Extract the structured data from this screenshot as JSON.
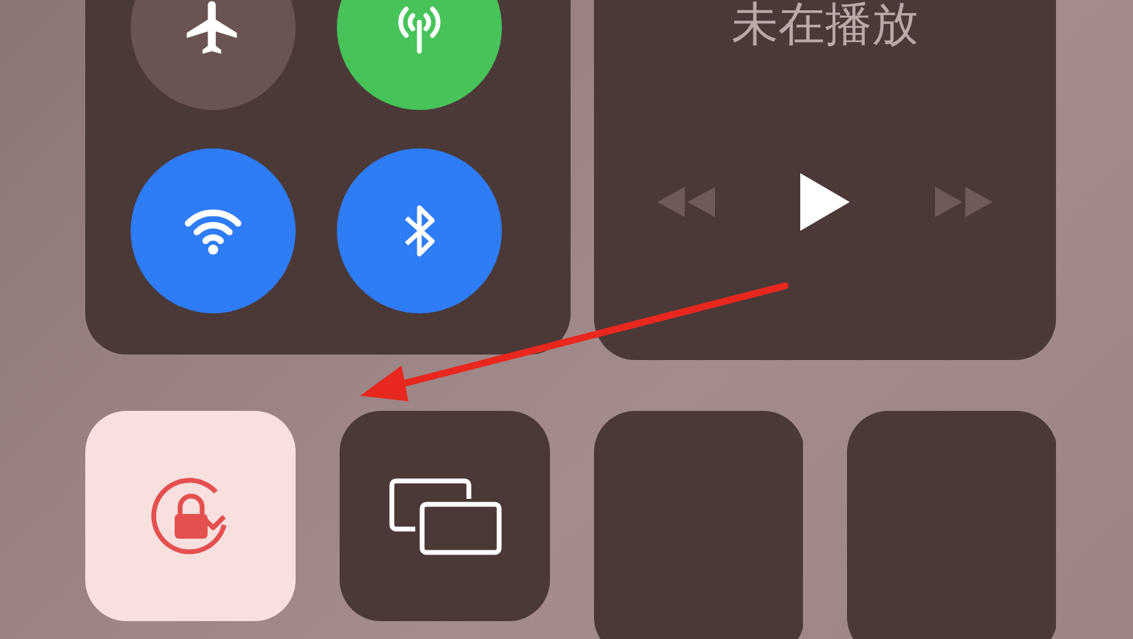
{
  "connectivity": [
    {
      "kind": "airplane",
      "on": false
    },
    {
      "kind": "cellular",
      "on": true
    },
    {
      "kind": "wifi",
      "on": true
    },
    {
      "kind": "bluetooth",
      "on": true
    }
  ],
  "now_playing": {
    "status": "未在播放",
    "controls": [
      {
        "kind": "rewind",
        "disabled": true
      },
      {
        "kind": "play",
        "disabled": false
      },
      {
        "kind": "forward",
        "disabled": true
      }
    ]
  },
  "tiles": [
    {
      "kind": "rotation-lock",
      "on": true
    },
    {
      "kind": "screen-mirroring",
      "on": false
    },
    {
      "kind": "blank"
    },
    {
      "kind": "blank"
    }
  ]
}
